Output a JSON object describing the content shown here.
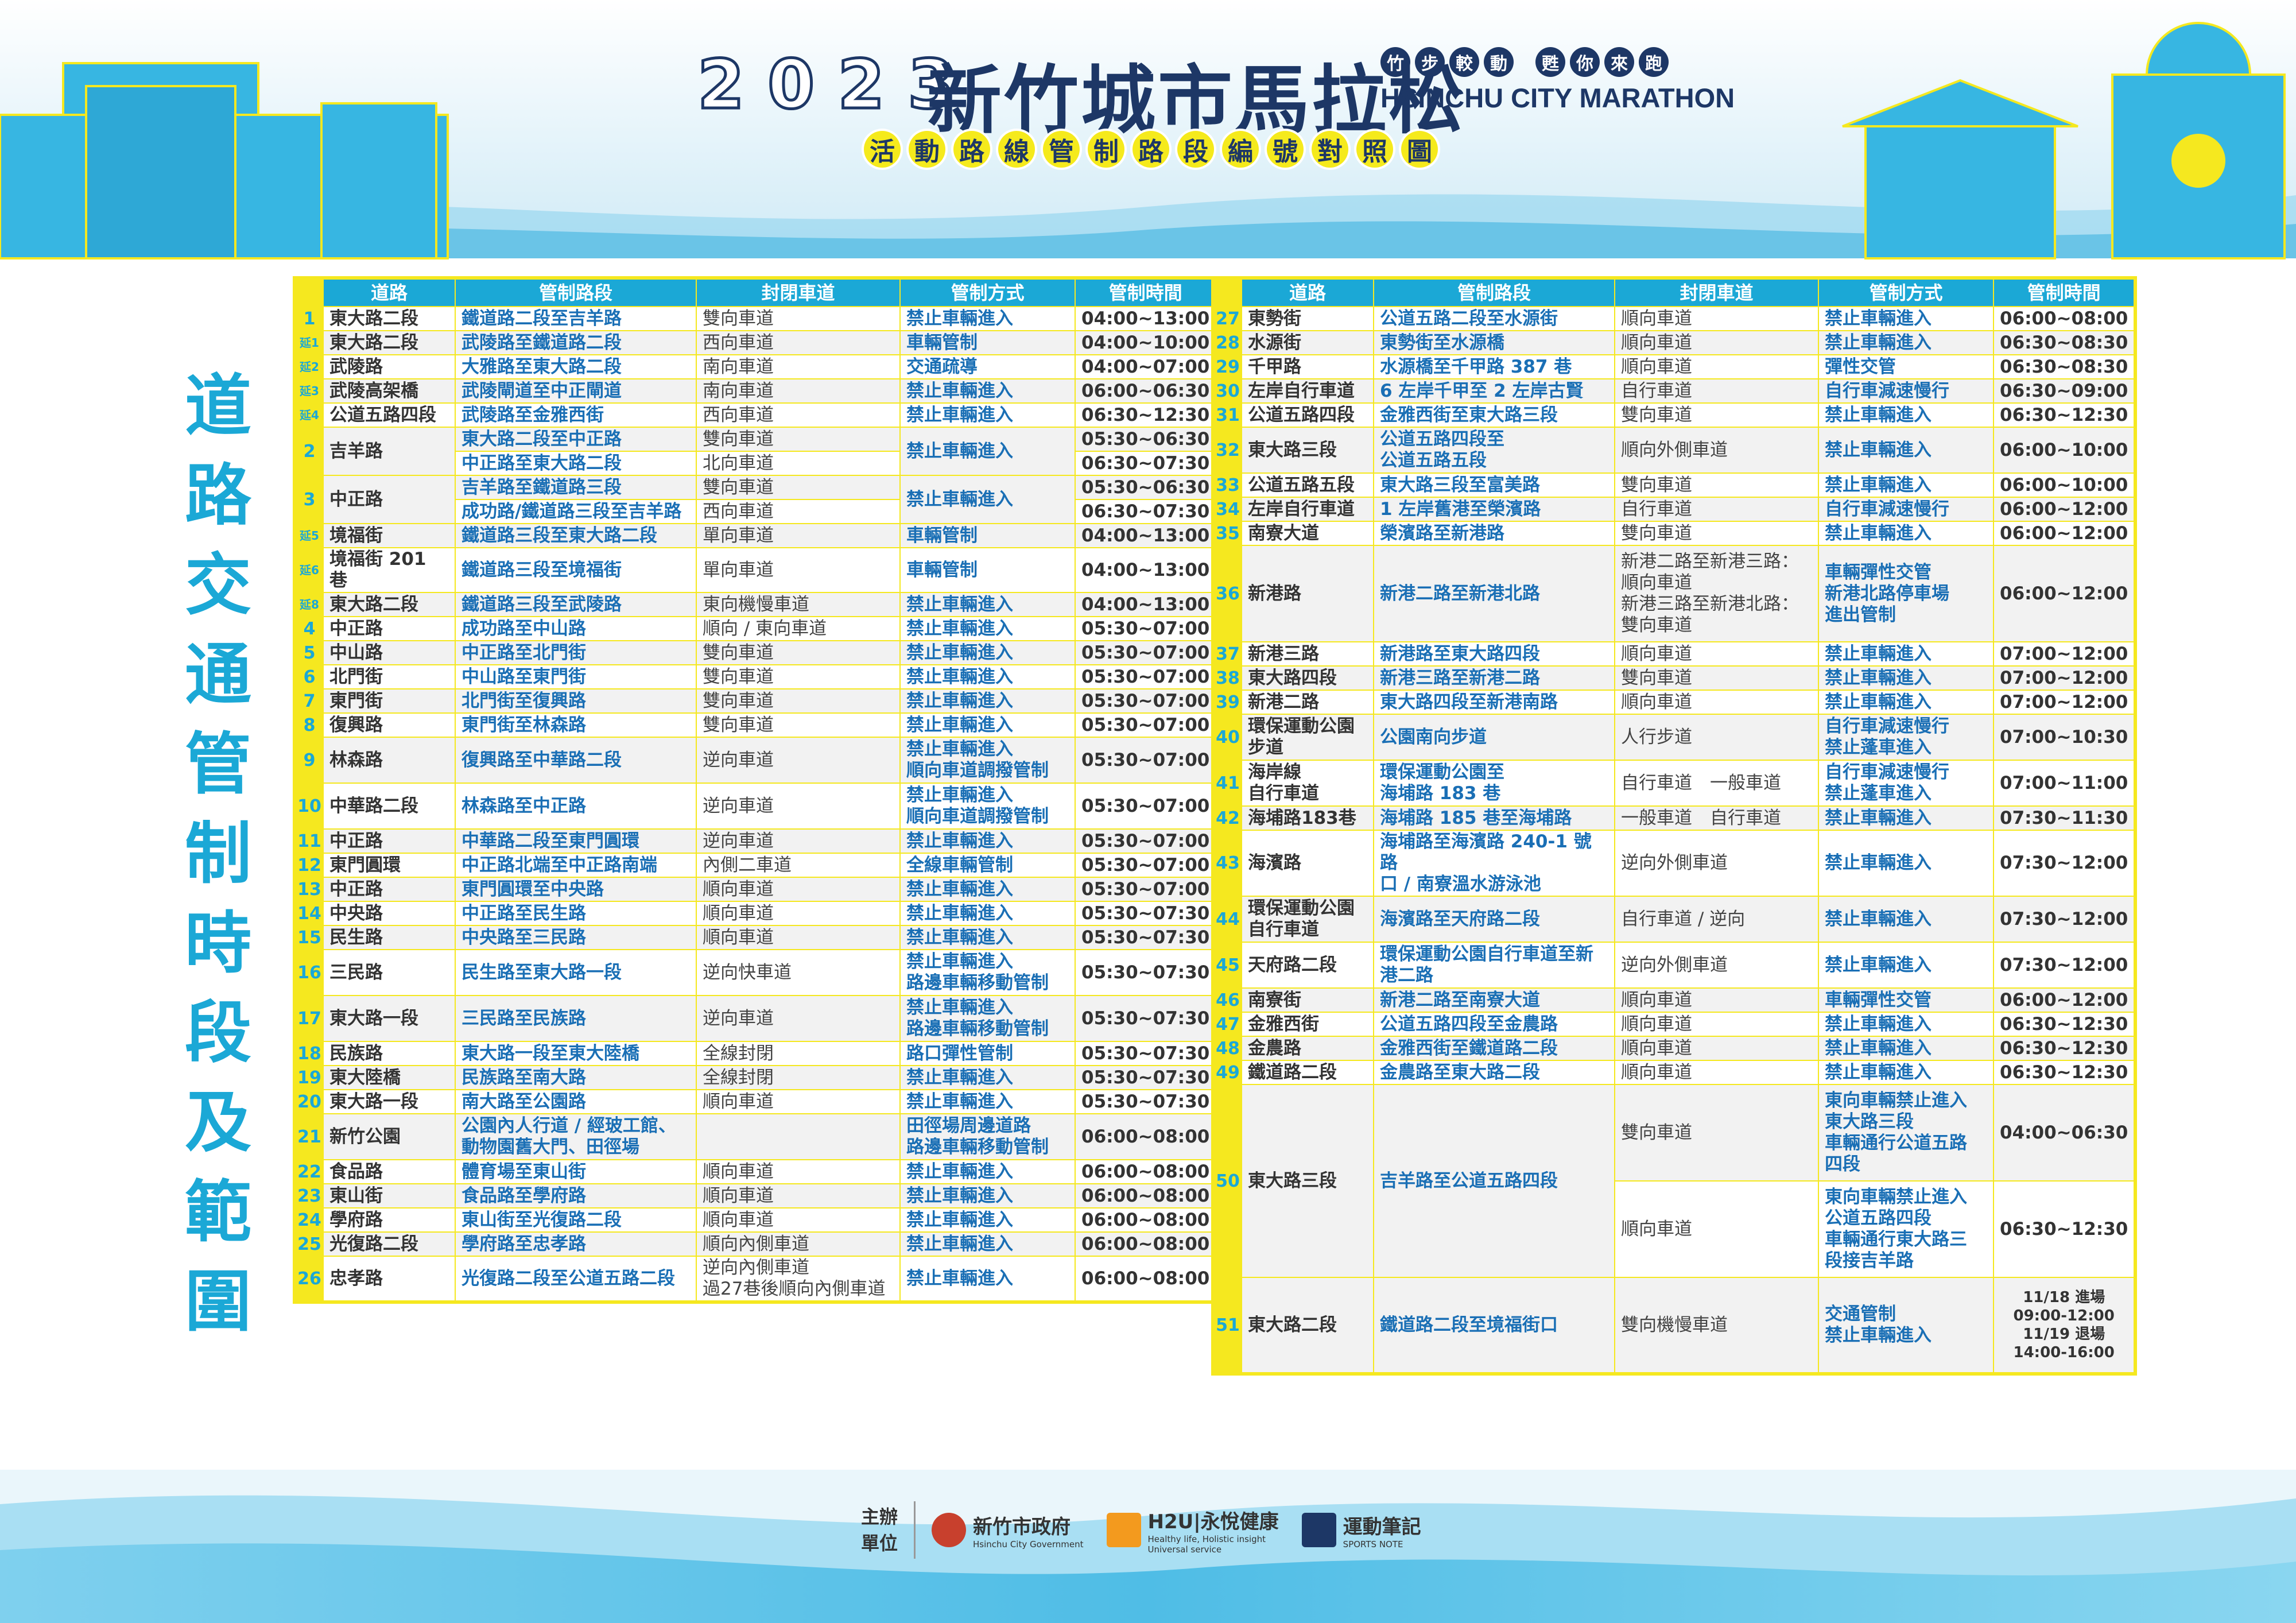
{
  "header": {
    "year": "2023",
    "title": "新竹城市馬拉松",
    "slogan": [
      "竹",
      "步",
      "較",
      "動",
      "",
      "甦",
      "你",
      "來",
      "跑"
    ],
    "title_en": "HSINCHU CITY MARATHON",
    "subtitle": [
      "活",
      "動",
      "路",
      "線",
      "管",
      "制",
      "路",
      "段",
      "編",
      "號",
      "對",
      "照",
      "圖"
    ]
  },
  "side_title": [
    "道",
    "路",
    "交",
    "通",
    "管",
    "制",
    "時",
    "段",
    "及",
    "範",
    "圍"
  ],
  "columns": [
    "",
    "道路",
    "管制路段",
    "封閉車道",
    "管制方式",
    "管制時間"
  ],
  "left_rows": [
    {
      "no": "1",
      "road": "東大路二段",
      "section": "鐵道路二段至吉羊路",
      "lane": "雙向車道",
      "mode": "禁止車輛進入",
      "time": "04:00~13:00"
    },
    {
      "no": "延1",
      "ext": true,
      "road": "東大路二段",
      "section": "武陵路至鐵道路二段",
      "lane": "西向車道",
      "mode": "車輛管制",
      "time": "04:00~10:00"
    },
    {
      "no": "延2",
      "ext": true,
      "road": "武陵路",
      "section": "大雅路至東大路二段",
      "lane": "南向車道",
      "mode": "交通疏導",
      "time": "04:00~07:00"
    },
    {
      "no": "延3",
      "ext": true,
      "road": "武陵高架橋",
      "section": "武陵閘道至中正閘道",
      "lane": "南向車道",
      "mode": "禁止車輛進入",
      "time": "06:00~06:30"
    },
    {
      "no": "延4",
      "ext": true,
      "road": "公道五路四段",
      "section": "武陵路至金雅西街",
      "lane": "西向車道",
      "mode": "禁止車輛進入",
      "time": "06:30~12:30"
    },
    {
      "no": "2",
      "road": "吉羊路",
      "section": "東大路二段至中正路",
      "lane": "雙向車道",
      "mode": "禁止車輛進入",
      "time": "05:30~06:30",
      "span": 2
    },
    {
      "cont": true,
      "section": "中正路至東大路二段",
      "lane": "北向車道",
      "time": "06:30~07:30"
    },
    {
      "no": "3",
      "road": "中正路",
      "section": "吉羊路至鐵道路三段",
      "lane": "雙向車道",
      "mode": "禁止車輛進入",
      "time": "05:30~06:30",
      "span": 2
    },
    {
      "cont": true,
      "section": "成功路/鐵道路三段至吉羊路",
      "lane": "西向車道",
      "time": "06:30~07:30"
    },
    {
      "no": "延5",
      "ext": true,
      "road": "境福街",
      "section": "鐵道路三段至東大路二段",
      "lane": "單向車道",
      "mode": "車輛管制",
      "time": "04:00~13:00"
    },
    {
      "no": "延6",
      "ext": true,
      "road": "境福街 201 巷",
      "section": "鐵道路三段至境福街",
      "lane": "單向車道",
      "mode": "車輛管制",
      "time": "04:00~13:00"
    },
    {
      "no": "延8",
      "ext": true,
      "road": "東大路二段",
      "section": "鐵道路三段至武陵路",
      "lane": "東向機慢車道",
      "mode": "禁止車輛進入",
      "time": "04:00~13:00"
    },
    {
      "no": "4",
      "road": "中正路",
      "section": "成功路至中山路",
      "lane": "順向 / 東向車道",
      "mode": "禁止車輛進入",
      "time": "05:30~07:00"
    },
    {
      "no": "5",
      "road": "中山路",
      "section": "中正路至北門街",
      "lane": "雙向車道",
      "mode": "禁止車輛進入",
      "time": "05:30~07:00"
    },
    {
      "no": "6",
      "road": "北門街",
      "section": "中山路至東門街",
      "lane": "雙向車道",
      "mode": "禁止車輛進入",
      "time": "05:30~07:00"
    },
    {
      "no": "7",
      "road": "東門街",
      "section": "北門街至復興路",
      "lane": "雙向車道",
      "mode": "禁止車輛進入",
      "time": "05:30~07:00"
    },
    {
      "no": "8",
      "road": "復興路",
      "section": "東門街至林森路",
      "lane": "雙向車道",
      "mode": "禁止車輛進入",
      "time": "05:30~07:00"
    },
    {
      "no": "9",
      "road": "林森路",
      "section": "復興路至中華路二段",
      "lane": "逆向車道",
      "mode": "禁止車輛進入\n順向車道調撥管制",
      "time": "05:30~07:00",
      "tall": true
    },
    {
      "no": "10",
      "road": "中華路二段",
      "section": "林森路至中正路",
      "lane": "逆向車道",
      "mode": "禁止車輛進入\n順向車道調撥管制",
      "time": "05:30~07:00",
      "tall": true
    },
    {
      "no": "11",
      "road": "中正路",
      "section": "中華路二段至東門圓環",
      "lane": "逆向車道",
      "mode": "禁止車輛進入",
      "time": "05:30~07:00"
    },
    {
      "no": "12",
      "road": "東門圓環",
      "section": "中正路北端至中正路南端",
      "lane": "內側二車道",
      "mode": "全線車輛管制",
      "time": "05:30~07:00"
    },
    {
      "no": "13",
      "road": "中正路",
      "section": "東門圓環至中央路",
      "lane": "順向車道",
      "mode": "禁止車輛進入",
      "time": "05:30~07:00"
    },
    {
      "no": "14",
      "road": "中央路",
      "section": "中正路至民生路",
      "lane": "順向車道",
      "mode": "禁止車輛進入",
      "time": "05:30~07:30"
    },
    {
      "no": "15",
      "road": "民生路",
      "section": "中央路至三民路",
      "lane": "順向車道",
      "mode": "禁止車輛進入",
      "time": "05:30~07:30"
    },
    {
      "no": "16",
      "road": "三民路",
      "section": "民生路至東大路一段",
      "lane": "逆向快車道",
      "mode": "禁止車輛進入\n路邊車輛移動管制",
      "time": "05:30~07:30",
      "tall": true
    },
    {
      "no": "17",
      "road": "東大路一段",
      "section": "三民路至民族路",
      "lane": "逆向車道",
      "mode": "禁止車輛進入\n路邊車輛移動管制",
      "time": "05:30~07:30",
      "tall": true
    },
    {
      "no": "18",
      "road": "民族路",
      "section": "東大路一段至東大陸橋",
      "lane": "全線封閉",
      "mode": "路口彈性管制",
      "time": "05:30~07:30"
    },
    {
      "no": "19",
      "road": "東大陸橋",
      "section": "民族路至南大路",
      "lane": "全線封閉",
      "mode": "禁止車輛進入",
      "time": "05:30~07:30"
    },
    {
      "no": "20",
      "road": "東大路一段",
      "section": "南大路至公園路",
      "lane": "順向車道",
      "mode": "禁止車輛進入",
      "time": "05:30~07:30"
    },
    {
      "no": "21",
      "road": "新竹公園",
      "section": "公園內人行道 / 經玻工館、\n動物園舊大門、田徑場",
      "lane": "",
      "mode": "田徑場周邊道路\n路邊車輛移動管制",
      "time": "06:00~08:00",
      "tall": true
    },
    {
      "no": "22",
      "road": "食品路",
      "section": "體育場至東山街",
      "lane": "順向車道",
      "mode": "禁止車輛進入",
      "time": "06:00~08:00"
    },
    {
      "no": "23",
      "road": "東山街",
      "section": "食品路至學府路",
      "lane": "順向車道",
      "mode": "禁止車輛進入",
      "time": "06:00~08:00"
    },
    {
      "no": "24",
      "road": "學府路",
      "section": "東山街至光復路二段",
      "lane": "順向車道",
      "mode": "禁止車輛進入",
      "time": "06:00~08:00"
    },
    {
      "no": "25",
      "road": "光復路二段",
      "section": "學府路至忠孝路",
      "lane": "順向內側車道",
      "mode": "禁止車輛進入",
      "time": "06:00~08:00"
    },
    {
      "no": "26",
      "road": "忠孝路",
      "section": "光復路二段至公道五路二段",
      "lane": "逆向內側車道\n過27巷後順向內側車道",
      "mode": "禁止車輛進入",
      "time": "06:00~08:00",
      "tall": true
    }
  ],
  "right_rows": [
    {
      "no": "27",
      "road": "東勢街",
      "section": "公道五路二段至水源街",
      "lane": "順向車道",
      "mode": "禁止車輛進入",
      "time": "06:00~08:00"
    },
    {
      "no": "28",
      "road": "水源街",
      "section": "東勢街至水源橋",
      "lane": "順向車道",
      "mode": "禁止車輛進入",
      "time": "06:30~08:30"
    },
    {
      "no": "29",
      "road": "千甲路",
      "section": "水源橋至千甲路 387 巷",
      "lane": "順向車道",
      "mode": "彈性交管",
      "time": "06:30~08:30"
    },
    {
      "no": "30",
      "road": "左岸自行車道",
      "section": "6 左岸千甲至 2 左岸古賢",
      "lane": "自行車道",
      "mode": "自行車減速慢行",
      "time": "06:30~09:00"
    },
    {
      "no": "31",
      "road": "公道五路四段",
      "section": "金雅西街至東大路三段",
      "lane": "雙向車道",
      "mode": "禁止車輛進入",
      "time": "06:30~12:30"
    },
    {
      "no": "32",
      "road": "東大路三段",
      "section": "公道五路四段至\n公道五路五段",
      "lane": "順向外側車道",
      "mode": "禁止車輛進入",
      "time": "06:00~10:00",
      "tall": true
    },
    {
      "no": "33",
      "road": "公道五路五段",
      "section": "東大路三段至富美路",
      "lane": "雙向車道",
      "mode": "禁止車輛進入",
      "time": "06:00~10:00"
    },
    {
      "no": "34",
      "road": "左岸自行車道",
      "section": "1 左岸舊港至榮濱路",
      "lane": "自行車道",
      "mode": "自行車減速慢行",
      "time": "06:00~12:00"
    },
    {
      "no": "35",
      "road": "南寮大道",
      "section": "榮濱路至新港路",
      "lane": "雙向車道",
      "mode": "禁止車輛進入",
      "time": "06:00~12:00"
    },
    {
      "no": "36",
      "road": "新港路",
      "section": "新港二路至新港北路",
      "lane": "新港二路至新港三路：\n順向車道\n新港三路至新港北路：\n雙向車道",
      "mode": "車輛彈性交管\n新港北路停車場\n進出管制",
      "time": "06:00~12:00",
      "xtall": true
    },
    {
      "no": "37",
      "road": "新港三路",
      "section": "新港路至東大路四段",
      "lane": "順向車道",
      "mode": "禁止車輛進入",
      "time": "07:00~12:00"
    },
    {
      "no": "38",
      "road": "東大路四段",
      "section": "新港三路至新港二路",
      "lane": "雙向車道",
      "mode": "禁止車輛進入",
      "time": "07:00~12:00"
    },
    {
      "no": "39",
      "road": "新港二路",
      "section": "東大路四段至新港南路",
      "lane": "順向車道",
      "mode": "禁止車輛進入",
      "time": "07:00~12:00"
    },
    {
      "no": "40",
      "road": "環保運動公園\n步道",
      "section": "公園南向步道",
      "lane": "人行步道",
      "mode": "自行車減速慢行\n禁止蓬車進入",
      "time": "07:00~10:30",
      "tall": true
    },
    {
      "no": "41",
      "road": "海岸線\n自行車道",
      "section": "環保運動公園至\n海埔路 183 巷",
      "lane": "自行車道　一般車道",
      "mode": "自行車減速慢行\n禁止蓬車進入",
      "time": "07:00~11:00",
      "tall": true
    },
    {
      "no": "42",
      "road": "海埔路183巷",
      "section": "海埔路 185 巷至海埔路",
      "lane": "一般車道　自行車道",
      "mode": "禁止車輛進入",
      "time": "07:30~11:30"
    },
    {
      "no": "43",
      "road": "海濱路",
      "section": "海埔路至海濱路 240-1 號路\n口 / 南寮溫水游泳池",
      "lane": "逆向外側車道",
      "mode": "禁止車輛進入",
      "time": "07:30~12:00",
      "tall": true
    },
    {
      "no": "44",
      "road": "環保運動公園\n自行車道",
      "section": "海濱路至天府路二段",
      "lane": "自行車道 / 逆向",
      "mode": "禁止車輛進入",
      "time": "07:30~12:00",
      "tall": true
    },
    {
      "no": "45",
      "road": "天府路二段",
      "section": "環保運動公園自行車道至新\n港二路",
      "lane": "逆向外側車道",
      "mode": "禁止車輛進入",
      "time": "07:30~12:00",
      "tall": true
    },
    {
      "no": "46",
      "road": "南寮街",
      "section": "新港二路至南寮大道",
      "lane": "順向車道",
      "mode": "車輛彈性交管",
      "time": "06:00~12:00"
    },
    {
      "no": "47",
      "road": "金雅西街",
      "section": "公道五路四段至金農路",
      "lane": "順向車道",
      "mode": "禁止車輛進入",
      "time": "06:30~12:30"
    },
    {
      "no": "48",
      "road": "金農路",
      "section": "金雅西街至鐵道路二段",
      "lane": "順向車道",
      "mode": "禁止車輛進入",
      "time": "06:30~12:30"
    },
    {
      "no": "49",
      "road": "鐵道路二段",
      "section": "金農路至東大路二段",
      "lane": "順向車道",
      "mode": "禁止車輛進入",
      "time": "06:30~12:30"
    },
    {
      "no": "50",
      "road": "東大路三段",
      "section": "吉羊路至公道五路四段",
      "lane": "雙向車道",
      "mode": "東向車輛禁止進入\n東大路三段\n車輛通行公道五路\n四段",
      "time": "04:00~06:30",
      "span": 2,
      "big": true
    },
    {
      "cont": true,
      "lane": "順向車道",
      "mode": "東向車輛禁止進入\n公道五路四段\n車輛通行東大路三\n段接吉羊路",
      "time": "06:30~12:30",
      "big": true
    },
    {
      "no": "51",
      "road": "東大路二段",
      "section": "鐵道路二段至境福街口",
      "lane": "雙向機慢車道",
      "mode": "交通管制\n禁止車輛進入",
      "time": "11/18 進場\n09:00-12:00\n11/19 退場\n14:00-16:00",
      "xtall": true
    }
  ],
  "footer": {
    "organizer_label": [
      "主辦",
      "單位"
    ],
    "logos": [
      {
        "name": "新竹市政府",
        "sub": "Hsinchu City Government"
      },
      {
        "name": "H2U|永悅健康",
        "sub": "Healthy life, Holistic insight\nUniversal service"
      },
      {
        "name": "運動筆記",
        "sub": "SPORTS NOTE"
      }
    ]
  },
  "colors": {
    "navy": "#1d3766",
    "cyan": "#1ba8d6",
    "yellow": "#f5e81f",
    "link_blue": "#1a6fb5"
  }
}
